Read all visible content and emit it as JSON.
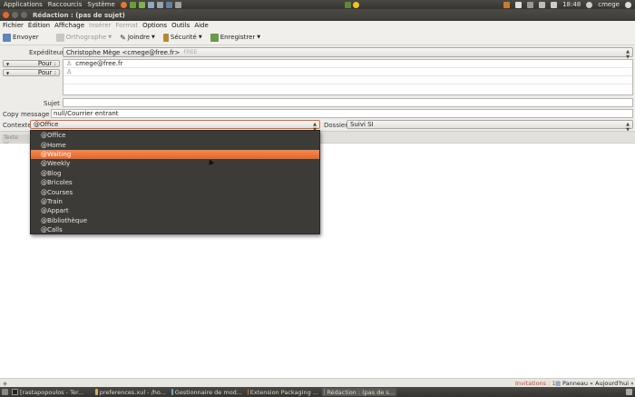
{
  "top_panel": {
    "menus": [
      "Applications",
      "Raccourcis",
      "Système"
    ],
    "time": "18:48",
    "user": "cmege"
  },
  "window": {
    "title": "Rédaction : (pas de sujet)"
  },
  "menubar": [
    {
      "label": "Fichier",
      "disabled": false
    },
    {
      "label": "Édition",
      "disabled": false
    },
    {
      "label": "Affichage",
      "disabled": false
    },
    {
      "label": "Insérer",
      "disabled": true
    },
    {
      "label": "Format",
      "disabled": true
    },
    {
      "label": "Options",
      "disabled": false
    },
    {
      "label": "Outils",
      "disabled": false
    },
    {
      "label": "Aide",
      "disabled": false
    }
  ],
  "toolbar": {
    "send": "Envoyer",
    "spelling": "Orthographe",
    "attach": "Joindre",
    "security": "Sécurité",
    "save": "Enregistrer"
  },
  "header": {
    "from_label": "Expéditeur :",
    "from_value": "Christophe Mège <cmege@free.fr>",
    "from_account": "FREE",
    "to_label_1": "Pour :",
    "to_label_2": "Pour :",
    "to_value_1": "cmege@free.fr",
    "to_value_2": "",
    "subject_label": "Sujet :",
    "subject_value": "",
    "copy_label": "Copy message to:",
    "copy_value": "null/Courrier entrant",
    "context_label": "Contexte",
    "context_value": "@Office",
    "folder_label": "Dossier",
    "folder_value": "Suivi SI"
  },
  "format_bar": {
    "style": "Texte pr..."
  },
  "dropdown": {
    "selected_index": 2,
    "items": [
      "@Office",
      "@Home",
      "@Waiting",
      "@Weekly",
      "@Blog",
      "@Bricoles",
      "@Courses",
      "@Train",
      "@Appart",
      "@Bibliothèque",
      "@Calls"
    ]
  },
  "statusbar": {
    "invitations": "Invitations : 1",
    "panel": "Panneau « Aujourd'hui »"
  },
  "taskbar": [
    {
      "label": "[rastapopoulos - Ter...",
      "active": false
    },
    {
      "label": "preferences.xul - /ho...",
      "active": false
    },
    {
      "label": "Gestionnaire de mod...",
      "active": false
    },
    {
      "label": "Extension Packaging ...",
      "active": false
    },
    {
      "label": "Rédaction : (pas de s...",
      "active": true
    }
  ],
  "colors": {
    "accent": "#e8652c",
    "dropdown_bg": "#3c3b37",
    "panel_bg": "#3c3b37"
  }
}
